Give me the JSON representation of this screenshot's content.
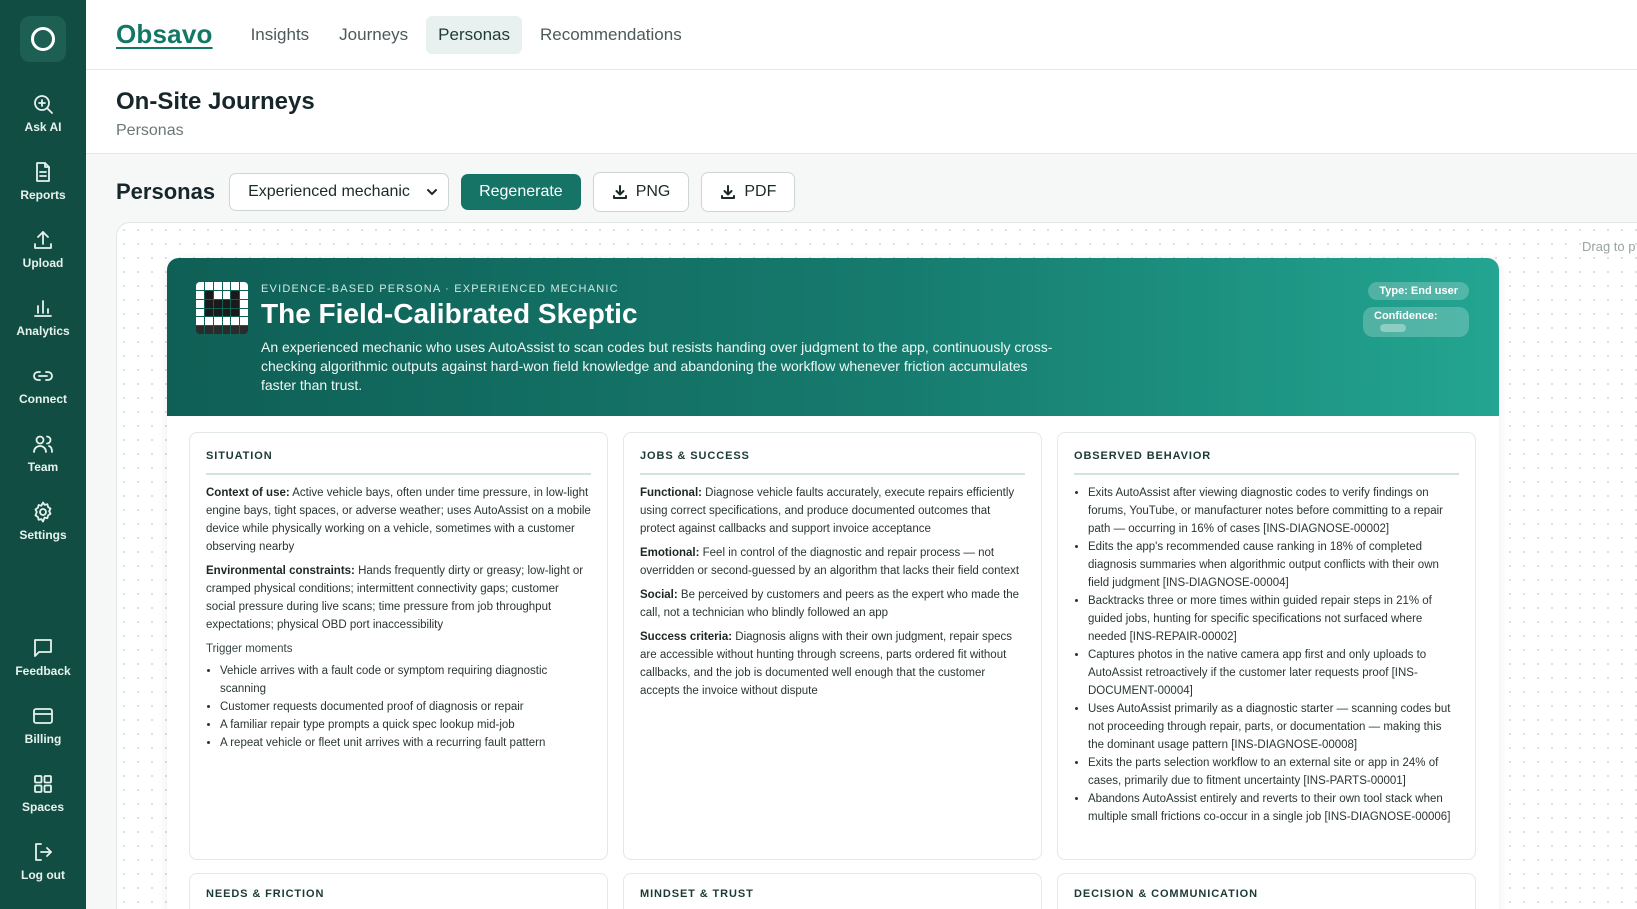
{
  "brand": "Obsavo",
  "sidebar": {
    "items": [
      {
        "label": "Ask AI",
        "icon": "search-sparkle-icon"
      },
      {
        "label": "Reports",
        "icon": "document-icon"
      },
      {
        "label": "Upload",
        "icon": "upload-icon"
      },
      {
        "label": "Analytics",
        "icon": "bar-chart-icon"
      },
      {
        "label": "Connect",
        "icon": "link-icon"
      },
      {
        "label": "Team",
        "icon": "users-icon"
      },
      {
        "label": "Settings",
        "icon": "gear-icon"
      }
    ],
    "bottom_items": [
      {
        "label": "Feedback",
        "icon": "message-icon"
      },
      {
        "label": "Billing",
        "icon": "credit-card-icon"
      },
      {
        "label": "Spaces",
        "icon": "grid-icon"
      },
      {
        "label": "Log out",
        "icon": "logout-icon"
      }
    ]
  },
  "nav": {
    "tabs": [
      "Insights",
      "Journeys",
      "Personas",
      "Recommendations"
    ],
    "active_tab": "Personas"
  },
  "page": {
    "title": "On-Site Journeys",
    "subtitle": "Personas"
  },
  "toolbar": {
    "title": "Personas",
    "selected_persona": "Experienced mechanic",
    "regenerate_label": "Regenerate",
    "png_label": "PNG",
    "pdf_label": "PDF"
  },
  "canvas": {
    "drag_hint": "Drag to p"
  },
  "persona": {
    "eyebrow": "EVIDENCE-BASED PERSONA · EXPERIENCED MECHANIC",
    "name": "The Field-Calibrated Skeptic",
    "description": "An experienced mechanic who uses AutoAssist to scan codes but resists handing over judgment to the app, continuously cross-checking algorithmic outputs against hard-won field knowledge and abandoning the workflow whenever friction accumulates faster than trust.",
    "type_label": "Type: End user",
    "confidence_label": "Confidence:",
    "colors": {
      "header_start": "#0f5f55",
      "header_end": "#23a592",
      "accent": "#157466"
    }
  },
  "situation": {
    "title": "SITUATION",
    "context_label": "Context of use:",
    "context_text": "Active vehicle bays, often under time pressure, in low-light engine bays, tight spaces, or adverse weather; uses AutoAssist on a mobile device while physically working on a vehicle, sometimes with a customer observing nearby",
    "env_label": "Environmental constraints:",
    "env_text": "Hands frequently dirty or greasy; low-light or cramped physical conditions; intermittent connectivity gaps; customer social pressure during live scans; time pressure from job throughput expectations; physical OBD port inaccessibility",
    "trigger_label": "Trigger moments",
    "triggers": [
      "Vehicle arrives with a fault code or symptom requiring diagnostic scanning",
      "Customer requests documented proof of diagnosis or repair",
      "A familiar repair type prompts a quick spec lookup mid-job",
      "A repeat vehicle or fleet unit arrives with a recurring fault pattern"
    ]
  },
  "jobs": {
    "title": "JOBS & SUCCESS",
    "functional_label": "Functional:",
    "functional_text": "Diagnose vehicle faults accurately, execute repairs efficiently using correct specifications, and produce documented outcomes that protect against callbacks and support invoice acceptance",
    "emotional_label": "Emotional:",
    "emotional_text": "Feel in control of the diagnostic and repair process — not overridden or second-guessed by an algorithm that lacks their field context",
    "social_label": "Social:",
    "social_text": "Be perceived by customers and peers as the expert who made the call, not a technician who blindly followed an app",
    "success_label": "Success criteria:",
    "success_text": "Diagnosis aligns with their own judgment, repair specs are accessible without hunting through screens, parts ordered fit without callbacks, and the job is documented well enough that the customer accepts the invoice without dispute"
  },
  "behavior": {
    "title": "OBSERVED BEHAVIOR",
    "items": [
      "Exits AutoAssist after viewing diagnostic codes to verify findings on forums, YouTube, or manufacturer notes before committing to a repair path — occurring in 16% of cases [INS-DIAGNOSE-00002]",
      "Edits the app's recommended cause ranking in 18% of completed diagnosis summaries when algorithmic output conflicts with their own field judgment [INS-DIAGNOSE-00004]",
      "Backtracks three or more times within guided repair steps in 21% of guided jobs, hunting for specific specifications not surfaced where needed [INS-REPAIR-00002]",
      "Captures photos in the native camera app first and only uploads to AutoAssist retroactively if the customer later requests proof [INS-DOCUMENT-00004]",
      "Uses AutoAssist primarily as a diagnostic starter — scanning codes but not proceeding through repair, parts, or documentation — making this the dominant usage pattern [INS-DIAGNOSE-00008]",
      "Exits the parts selection workflow to an external site or app in 24% of cases, primarily due to fitment uncertainty [INS-PARTS-00001]",
      "Abandons AutoAssist entirely and reverts to their own tool stack when multiple small frictions co-occur in a single job [INS-DIAGNOSE-00006]"
    ]
  },
  "lower_sections": [
    "NEEDS & FRICTION",
    "MINDSET & TRUST",
    "DECISION & COMMUNICATION"
  ]
}
